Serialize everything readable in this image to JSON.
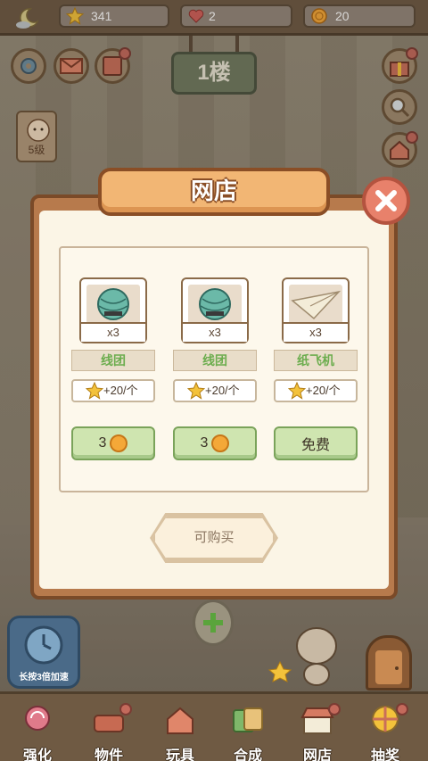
{
  "top_bar": {
    "stars": "341",
    "hearts": "2",
    "coins": "20"
  },
  "floor_sign": "1楼",
  "avatar": {
    "level": "5级"
  },
  "modal": {
    "title": "网店",
    "items": [
      {
        "name": "线团",
        "qty": "x3",
        "reward": "+20/个",
        "price": "3",
        "price_has_coin": true
      },
      {
        "name": "线团",
        "qty": "x3",
        "reward": "+20/个",
        "price": "3",
        "price_has_coin": true
      },
      {
        "name": "纸飞机",
        "qty": "x3",
        "reward": "+20/个",
        "price": "免费",
        "price_has_coin": false
      }
    ],
    "can_buy_label": "可购买"
  },
  "speed_label": "长按3倍加速",
  "nav": [
    {
      "label": "强化"
    },
    {
      "label": "物件"
    },
    {
      "label": "玩具"
    },
    {
      "label": "合成"
    },
    {
      "label": "网店"
    },
    {
      "label": "抽奖"
    }
  ],
  "colors": {
    "accent_orange": "#f2b674",
    "buy_green": "#cfe5b0",
    "name_green": "#6cad4e",
    "close_red": "#e8816b"
  }
}
